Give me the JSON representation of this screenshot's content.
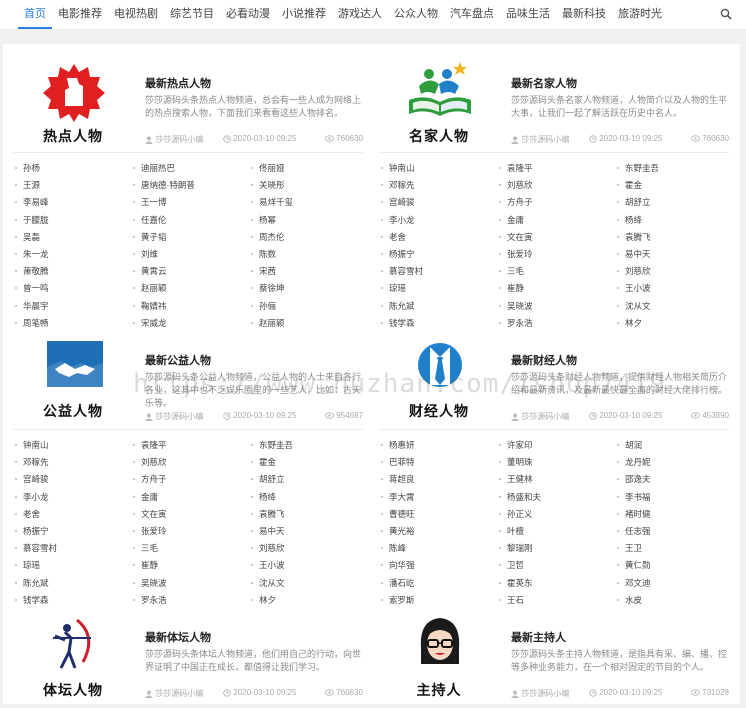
{
  "nav": {
    "items": [
      "首页",
      "电影推荐",
      "电视热剧",
      "综艺节目",
      "必看动漫",
      "小说推荐",
      "游戏达人",
      "公众人物",
      "汽车盘点",
      "品味生活",
      "最新科技",
      "旅游时光"
    ],
    "active_index": 0,
    "search_icon": "search-icon"
  },
  "watermark": "https://www.huzhan.com/ishop7419",
  "cards": [
    {
      "logo_label": "热点人物",
      "title": "最新热点人物",
      "desc": "莎莎源码头条热点人物频道，总会有一些人成为网络上的热点搜索人物，下面我们来看看这些人物排名。",
      "author": "莎莎源码小编",
      "date": "2020-03-10 09:25",
      "views": "760630",
      "names": [
        "孙杨",
        "迪丽热巴",
        "佟丽娅",
        "王源",
        "唐纳德·特朗普",
        "关晓彤",
        "李易峰",
        "王一博",
        "易烊千玺",
        "于朦胧",
        "任嘉伦",
        "杨幂",
        "吴磊",
        "黄子韬",
        "周杰伦",
        "朱一龙",
        "刘维",
        "陈数",
        "萧敬腾",
        "黄霄云",
        "宋茜",
        "曾一鸣",
        "赵丽颖",
        "蔡徐坤",
        "华晨宇",
        "鞠婧祎",
        "孙俪",
        "周笔畅",
        "宋威龙",
        "赵丽颖"
      ]
    },
    {
      "logo_label": "名家人物",
      "title": "最新名家人物",
      "desc": "莎莎源码头条名家人物频道，人物简介以及人物的生平大事，让我们一起了解活跃在历史中名人。",
      "author": "莎莎源码小编",
      "date": "2020-03-10 09:25",
      "views": "760630",
      "names": [
        "钟南山",
        "袁隆平",
        "东野圭吾",
        "邓稼先",
        "刘慈欣",
        "霍金",
        "宫崎骏",
        "方舟子",
        "胡舒立",
        "李小龙",
        "金庸",
        "杨绛",
        "老舍",
        "文在寅",
        "袁腾飞",
        "杨振宁",
        "张爱玲",
        "易中天",
        "慕容雪村",
        "三毛",
        "刘慈欣",
        "琼瑶",
        "崔静",
        "王小波",
        "陈允斌",
        "吴晓波",
        "沈从文",
        "钱学森",
        "罗永浩",
        "林夕"
      ]
    },
    {
      "logo_label": "公益人物",
      "title": "最新公益人物",
      "desc": "莎莎源码头条公益人物频道，公益人物的人士来自各行各业，这其中也不乏娱乐圈里的一些艺人，比如：古天乐等。",
      "author": "莎莎源码小编",
      "date": "2020-03-10 09:25",
      "views": "954687",
      "names": [
        "钟南山",
        "袁隆平",
        "东野圭吾",
        "邓稼先",
        "刘慈欣",
        "霍金",
        "宫崎骏",
        "方舟子",
        "胡舒立",
        "李小龙",
        "金庸",
        "杨绛",
        "老舍",
        "文在寅",
        "袁腾飞",
        "杨振宁",
        "张爱玲",
        "易中天",
        "慕容雪村",
        "三毛",
        "刘慈欣",
        "琼瑶",
        "崔静",
        "王小波",
        "陈允斌",
        "吴晓波",
        "沈从文",
        "钱学森",
        "罗永浩",
        "林夕"
      ]
    },
    {
      "logo_label": "财经人物",
      "title": "最新财经人物",
      "desc": "莎莎源码头条财经人物频道，提供财经人物相关简历介绍和最新资讯，及最新最快最全面的财经大佬排行榜。",
      "author": "莎莎源码小编",
      "date": "2020-03-10 09:25",
      "views": "453890",
      "names": [
        "杨惠妍",
        "许家印",
        "胡润",
        "巴菲特",
        "董明珠",
        "龙丹妮",
        "蒋超良",
        "王健林",
        "邵逸夫",
        "李大霄",
        "杨盛和夫",
        "李书福",
        "曹德旺",
        "孙正义",
        "褚时健",
        "黄光裕",
        "叶檀",
        "任志强",
        "陈峰",
        "黎瑞刚",
        "王卫",
        "向华强",
        "卫哲",
        "黄仁勋",
        "潘石屹",
        "霍英东",
        "邓文迪",
        "索罗斯",
        "王石",
        "水皮"
      ]
    },
    {
      "logo_label": "体坛人物",
      "title": "最新体坛人物",
      "desc": "莎莎源码头条体坛人物频道，他们用自己的行动，向世界证明了中国正在成长，都值得让我们学习。",
      "author": "莎莎源码小编",
      "date": "2020-03-10 09:25",
      "views": "760630",
      "names": []
    },
    {
      "logo_label": "主持人",
      "title": "最新主持人",
      "desc": "莎莎源码头条主持人物频道，是指具有采、编、播、控等多种业务能力，在一个相对固定的节目的个人。",
      "author": "莎莎源码小编",
      "date": "2020-03-10 09:25",
      "views": "731028",
      "names": []
    }
  ]
}
